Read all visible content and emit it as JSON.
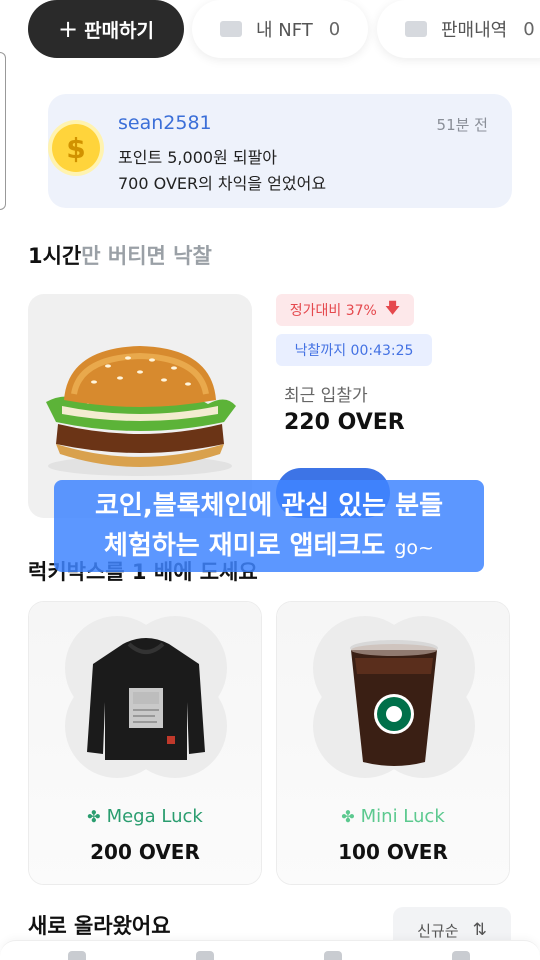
{
  "top": {
    "sell_label": "판매하기",
    "sell_plus": "+",
    "nft_label": "내 NFT",
    "nft_count": "0",
    "sales_label": "판매내역",
    "sales_count": "0"
  },
  "notice": {
    "username": "sean2581",
    "time": "51분 전",
    "coin_symbol": "$",
    "line1": "포인트 5,000원 되팔아",
    "line2": "700 OVER의 차익을 얻었어요"
  },
  "auction": {
    "title_bold": "1시간",
    "title_rest": "만 버티면 낙찰",
    "discount_badge": "정가대비 37%",
    "discount_arrow": "🡇",
    "timer_badge": "낙찰까지 00:43:25",
    "bid_label": "최근 입찰가",
    "bid_value": "220 OVER"
  },
  "caption": {
    "line1": "코인,블록체인에 관심 있는 분들",
    "line2": "체험하는 재미로 앱테크도",
    "line2_tail": "go~"
  },
  "lucky": {
    "title": "럭키박스를 1 배에 도세요",
    "cards": [
      {
        "tier": "Mega Luck",
        "price": "200 OVER",
        "clover": "✤"
      },
      {
        "tier": "Mini Luck",
        "price": "100 OVER",
        "clover": "✤"
      }
    ]
  },
  "new_section": {
    "title": "새로 올라왔어요",
    "sort_label": "신규순",
    "sort_icon": "⇅"
  },
  "colors": {
    "primary": "#3d74e6",
    "dark_button": "#2a2a2a",
    "mega": "#2a9d6f",
    "mini": "#5cc98f",
    "discount": "#e5484d"
  }
}
